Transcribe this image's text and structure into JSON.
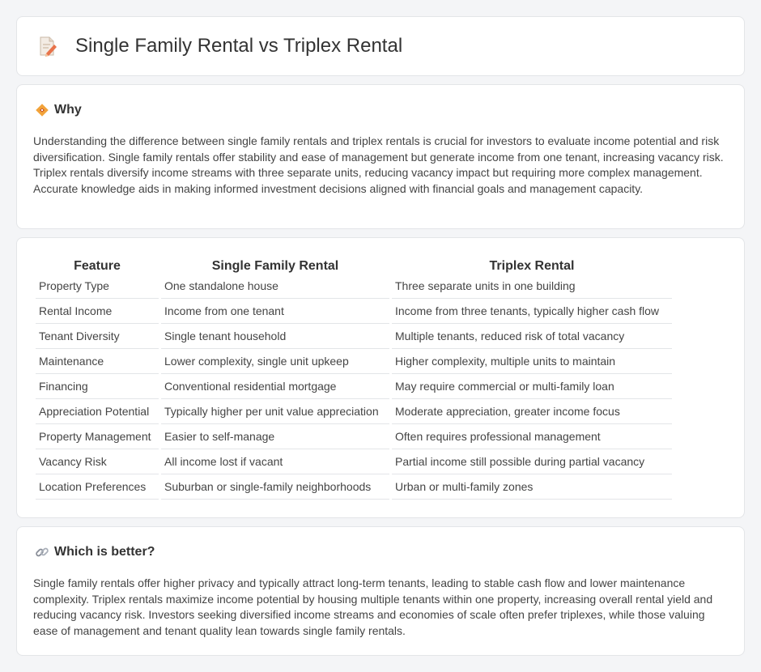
{
  "header": {
    "title": "Single Family Rental vs Triplex Rental"
  },
  "why": {
    "title": "Why",
    "text": "Understanding the difference between single family rentals and triplex rentals is crucial for investors to evaluate income potential and risk diversification. Single family rentals offer stability and ease of management but generate income from one tenant, increasing vacancy risk. Triplex rentals diversify income streams with three separate units, reducing vacancy impact but requiring more complex management. Accurate knowledge aids in making informed investment decisions aligned with financial goals and management capacity."
  },
  "table": {
    "headers": [
      "Feature",
      "Single Family Rental",
      "Triplex Rental"
    ],
    "rows": [
      [
        "Property Type",
        "One standalone house",
        "Three separate units in one building"
      ],
      [
        "Rental Income",
        "Income from one tenant",
        "Income from three tenants, typically higher cash flow"
      ],
      [
        "Tenant Diversity",
        "Single tenant household",
        "Multiple tenants, reduced risk of total vacancy"
      ],
      [
        "Maintenance",
        "Lower complexity, single unit upkeep",
        "Higher complexity, multiple units to maintain"
      ],
      [
        "Financing",
        "Conventional residential mortgage",
        "May require commercial or multi-family loan"
      ],
      [
        "Appreciation Potential",
        "Typically higher per unit value appreciation",
        "Moderate appreciation, greater income focus"
      ],
      [
        "Property Management",
        "Easier to self-manage",
        "Often requires professional management"
      ],
      [
        "Vacancy Risk",
        "All income lost if vacant",
        "Partial income still possible during partial vacancy"
      ],
      [
        "Location Preferences",
        "Suburban or single-family neighborhoods",
        "Urban or multi-family zones"
      ]
    ]
  },
  "better": {
    "title": "Which is better?",
    "text": "Single family rentals offer higher privacy and typically attract long-term tenants, leading to stable cash flow and lower maintenance complexity. Triplex rentals maximize income potential by housing multiple tenants within one property, increasing overall rental yield and reducing vacancy risk. Investors seeking diversified income streams and economies of scale often prefer triplexes, while those valuing ease of management and tenant quality lean towards single family rentals."
  }
}
